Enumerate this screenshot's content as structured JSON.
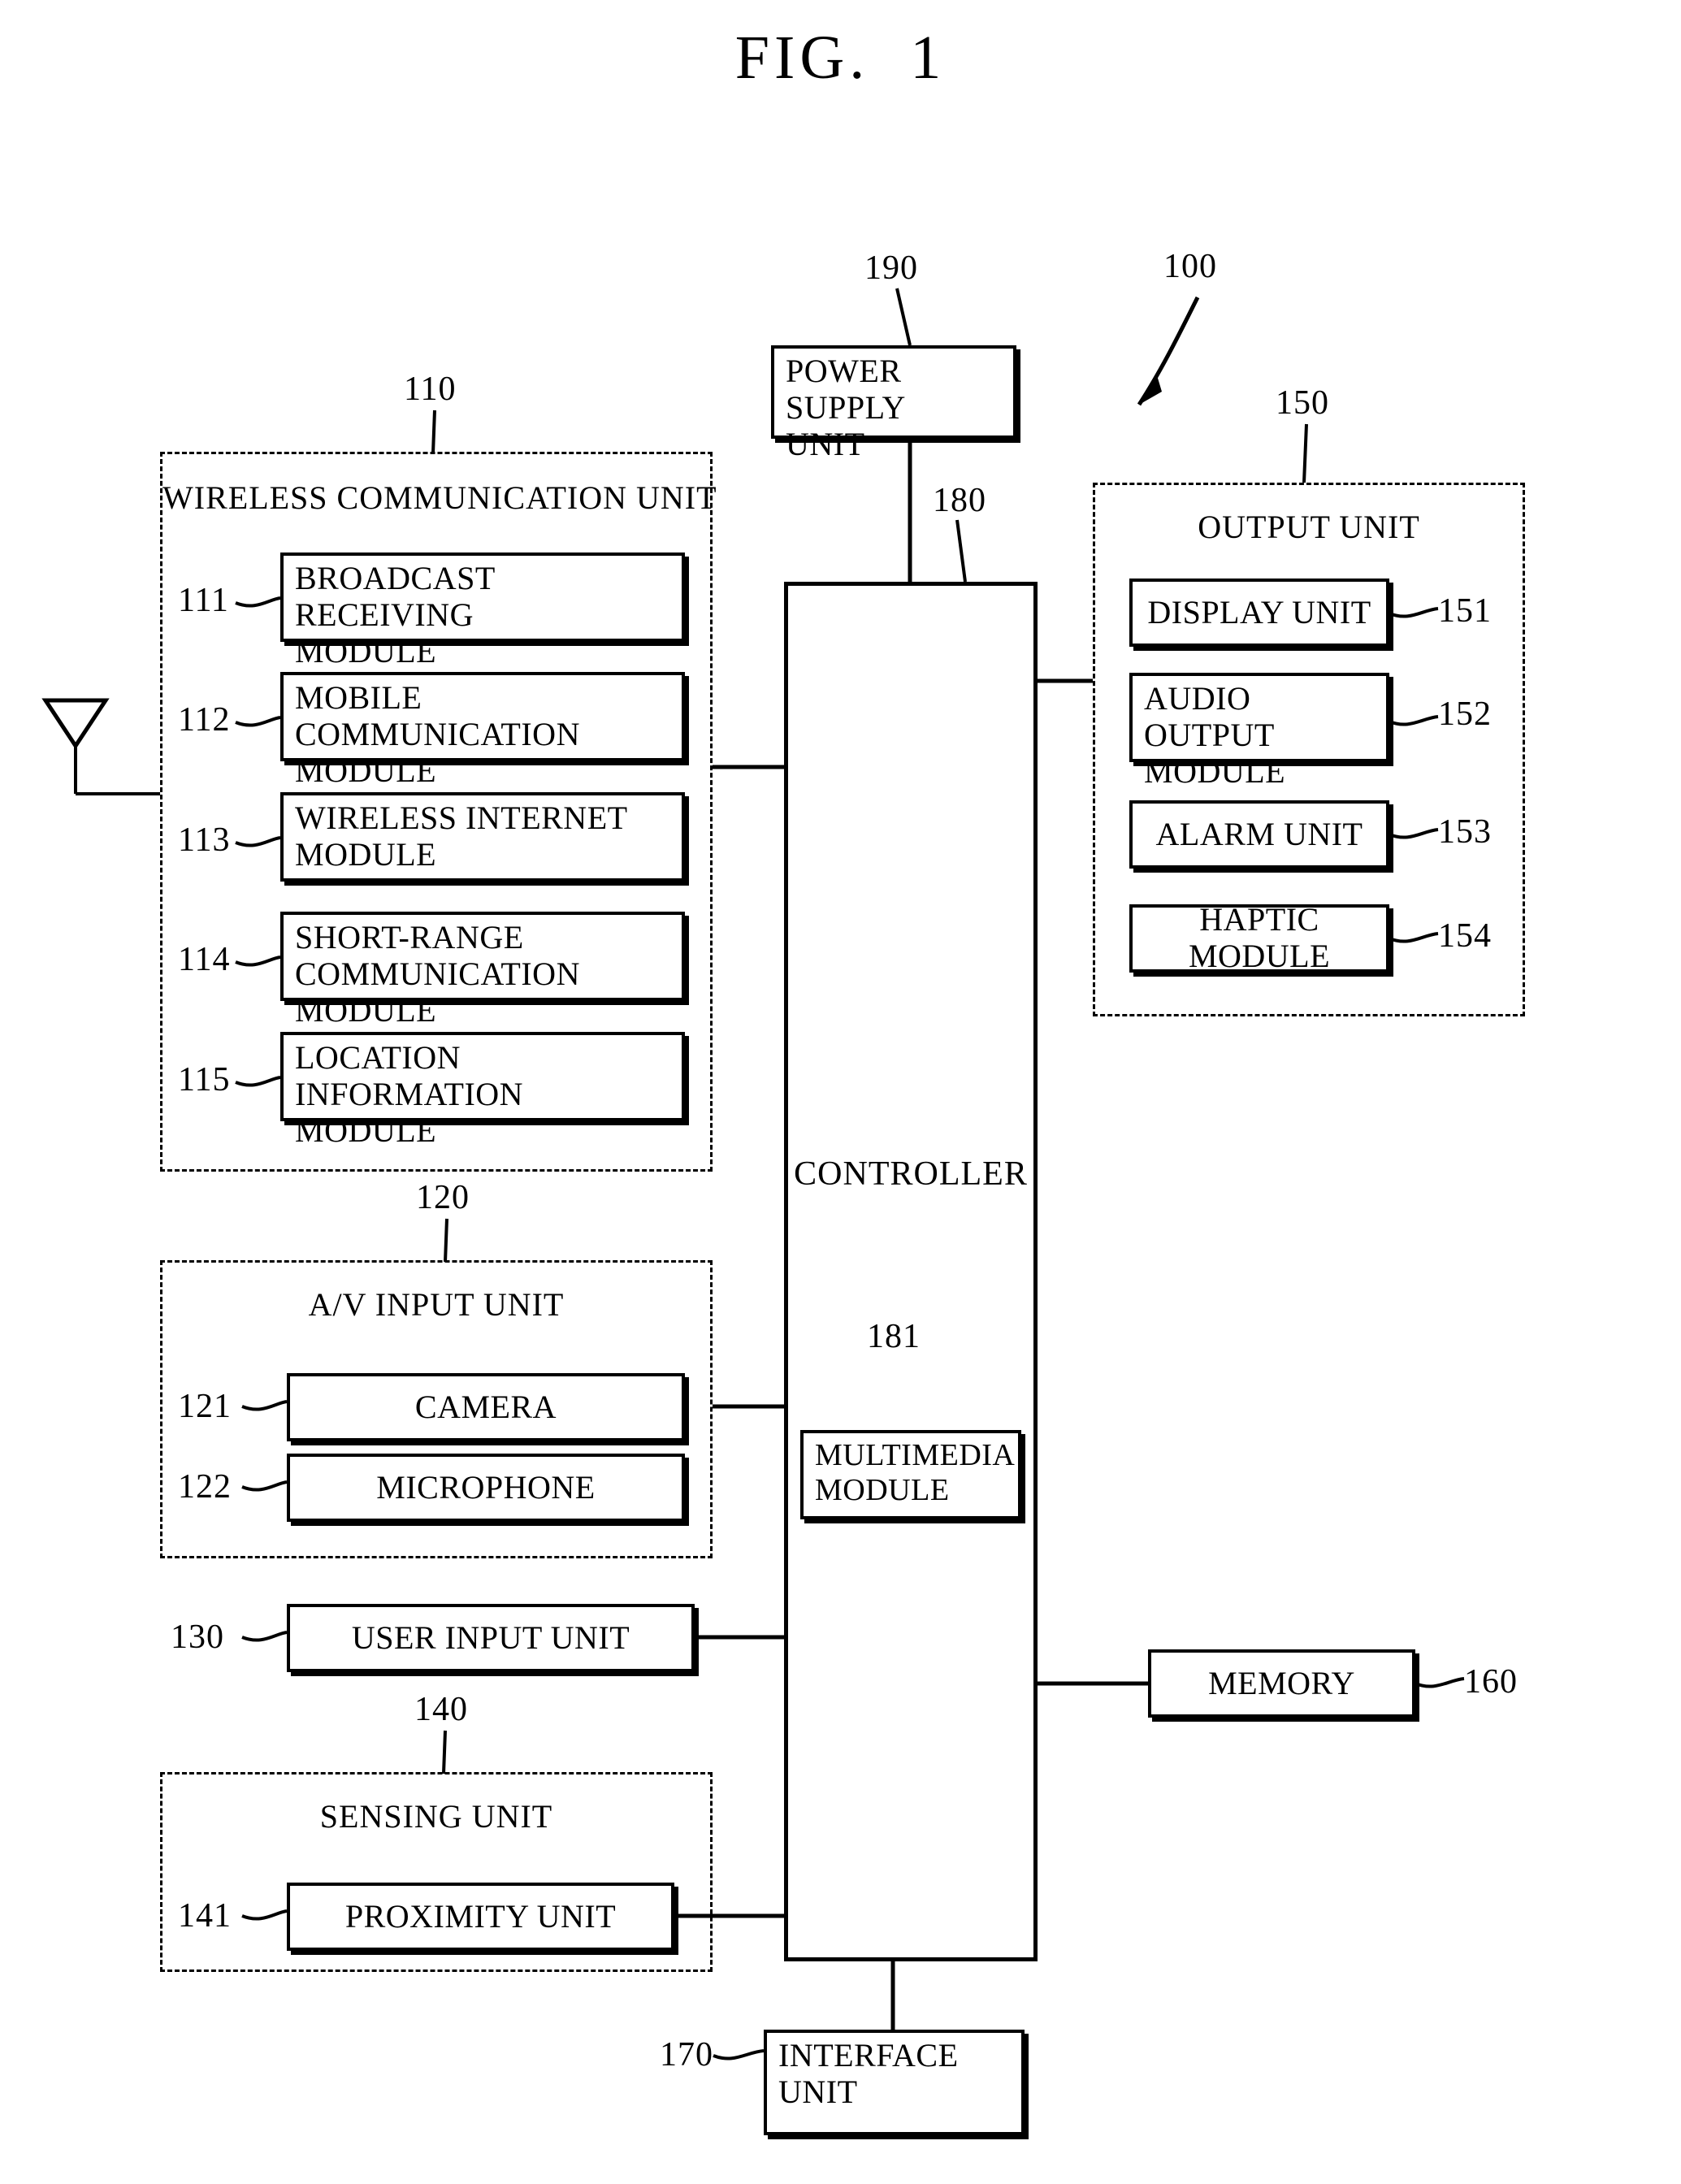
{
  "figure": {
    "title": "FIG.  1",
    "device_ref": "100"
  },
  "groups": {
    "wireless": {
      "ref": "110",
      "title": "WIRELESS COMMUNICATION UNIT",
      "modules": [
        {
          "ref": "111",
          "label": "BROADCAST RECEIVING\nMODULE"
        },
        {
          "ref": "112",
          "label": "MOBILE COMMUNICATION\nMODULE"
        },
        {
          "ref": "113",
          "label": "WIRELESS INTERNET\nMODULE"
        },
        {
          "ref": "114",
          "label": "SHORT-RANGE\nCOMMUNICATION MODULE"
        },
        {
          "ref": "115",
          "label": "LOCATION INFORMATION\nMODULE"
        }
      ]
    },
    "av_input": {
      "ref": "120",
      "title": "A/V INPUT UNIT",
      "modules": [
        {
          "ref": "121",
          "label": "CAMERA"
        },
        {
          "ref": "122",
          "label": "MICROPHONE"
        }
      ]
    },
    "sensing": {
      "ref": "140",
      "title": "SENSING UNIT",
      "modules": [
        {
          "ref": "141",
          "label": "PROXIMITY UNIT"
        }
      ]
    },
    "output": {
      "ref": "150",
      "title": "OUTPUT UNIT",
      "modules": [
        {
          "ref": "151",
          "label": "DISPLAY UNIT"
        },
        {
          "ref": "152",
          "label": "AUDIO OUTPUT\nMODULE"
        },
        {
          "ref": "153",
          "label": "ALARM UNIT"
        },
        {
          "ref": "154",
          "label": "HAPTIC MODULE"
        }
      ]
    }
  },
  "blocks": {
    "power_supply": {
      "ref": "190",
      "label": "POWER SUPPLY\nUNIT"
    },
    "controller": {
      "ref": "180",
      "label": "CONTROLLER"
    },
    "multimedia": {
      "ref": "181",
      "label": "MULTIMEDIA\nMODULE"
    },
    "user_input": {
      "ref": "130",
      "label": "USER INPUT UNIT"
    },
    "memory": {
      "ref": "160",
      "label": "MEMORY"
    },
    "interface": {
      "ref": "170",
      "label": "INTERFACE\nUNIT"
    }
  },
  "symbols": {
    "antenna": "antenna-symbol"
  }
}
